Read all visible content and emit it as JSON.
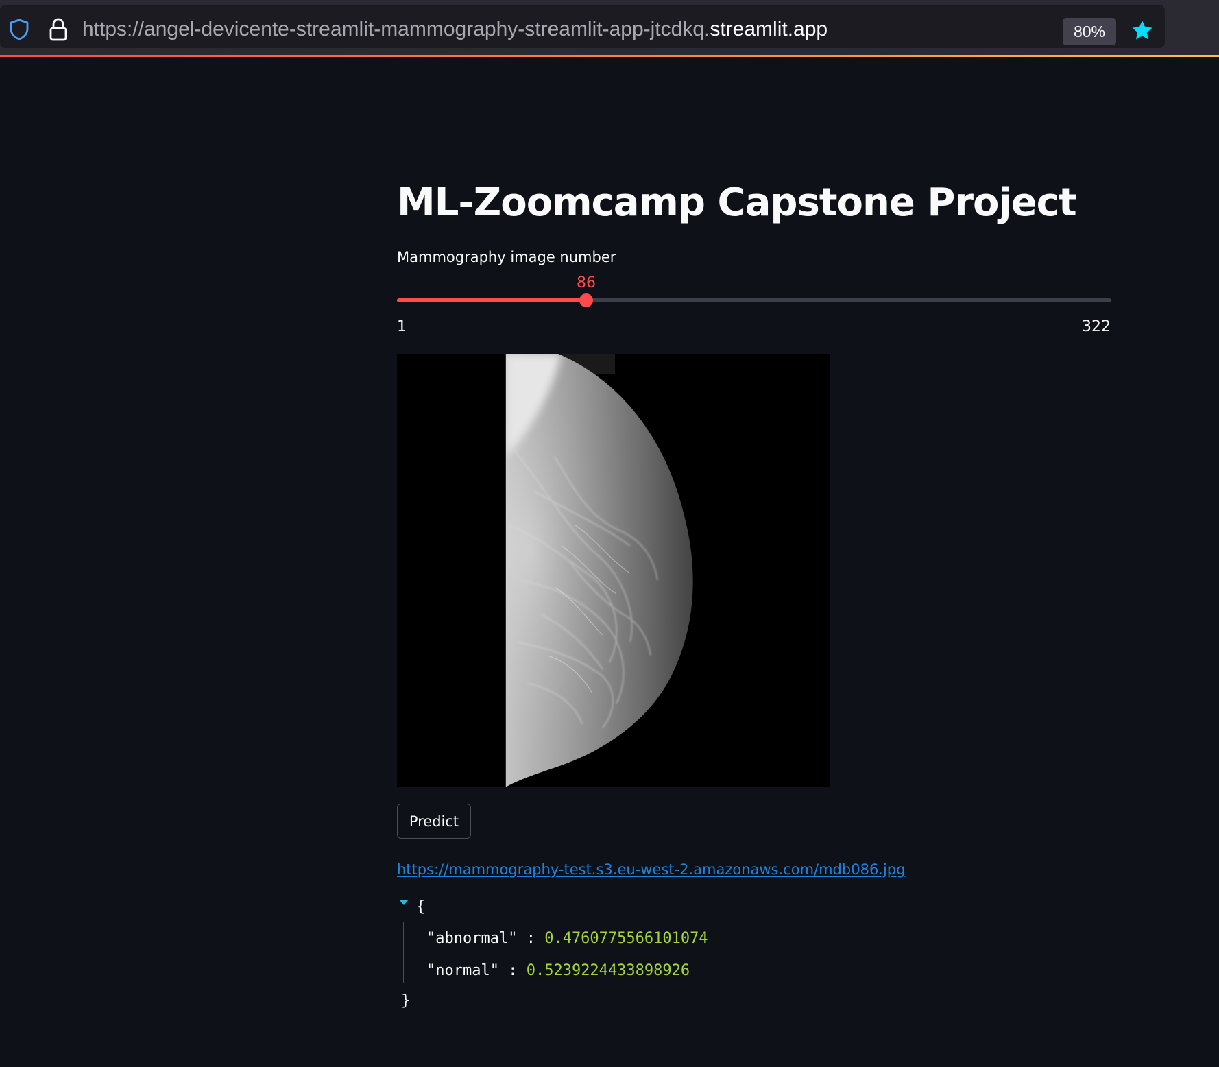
{
  "browser": {
    "url_prefix": "https://angel-devicente-streamlit-mammography-streamlit-app-jtcdkq.",
    "url_domain": "streamlit.app",
    "zoom": "80%"
  },
  "colors": {
    "accent": "#ff4b4b",
    "link": "#1c83e1",
    "json_value": "#a3d43a",
    "background": "#0e1117"
  },
  "app": {
    "title": "ML-Zoomcamp Capstone Project",
    "slider": {
      "label": "Mammography image number",
      "value": "86",
      "min": "1",
      "max": "322"
    },
    "predict_label": "Predict",
    "link": "https://mammography-test.s3.eu-west-2.amazonaws.com/mdb086.jpg",
    "json": {
      "open": "{",
      "close": "}",
      "rows": [
        {
          "key": "\"abnormal\"",
          "value": "0.4760775566101074"
        },
        {
          "key": "\"normal\"",
          "value": "0.5239224433898926"
        }
      ]
    }
  }
}
